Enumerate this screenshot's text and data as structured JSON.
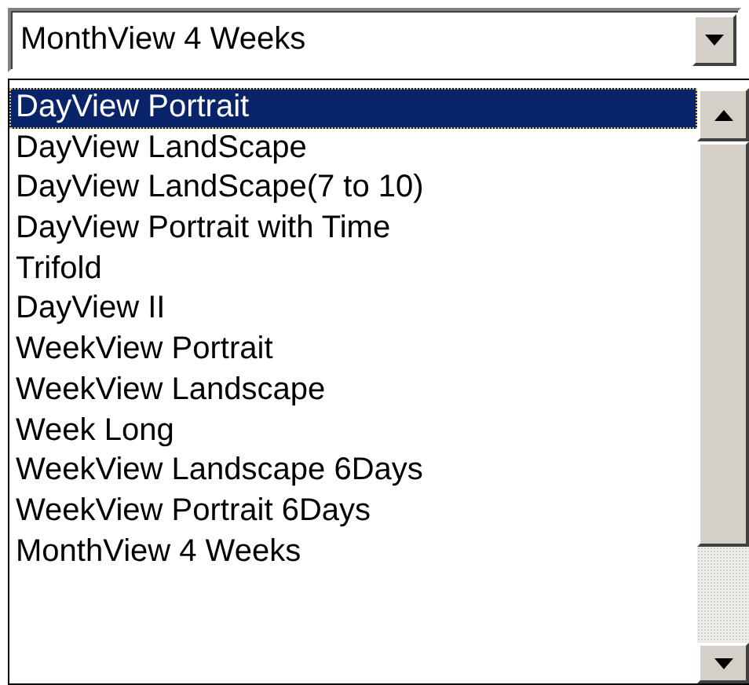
{
  "combo": {
    "value": "MonthView 4 Weeks"
  },
  "items": [
    {
      "label": "DayView Portrait",
      "selected": true
    },
    {
      "label": "DayView LandScape",
      "selected": false
    },
    {
      "label": "DayView LandScape(7 to 10)",
      "selected": false
    },
    {
      "label": "DayView Portrait with Time",
      "selected": false
    },
    {
      "label": "Trifold",
      "selected": false
    },
    {
      "label": "DayView II",
      "selected": false
    },
    {
      "label": "WeekView Portrait",
      "selected": false
    },
    {
      "label": "WeekView Landscape",
      "selected": false
    },
    {
      "label": "Week Long",
      "selected": false
    },
    {
      "label": "WeekView Landscape 6Days",
      "selected": false
    },
    {
      "label": "WeekView Portrait 6Days",
      "selected": false
    },
    {
      "label": "MonthView 4 Weeks",
      "selected": false
    }
  ]
}
